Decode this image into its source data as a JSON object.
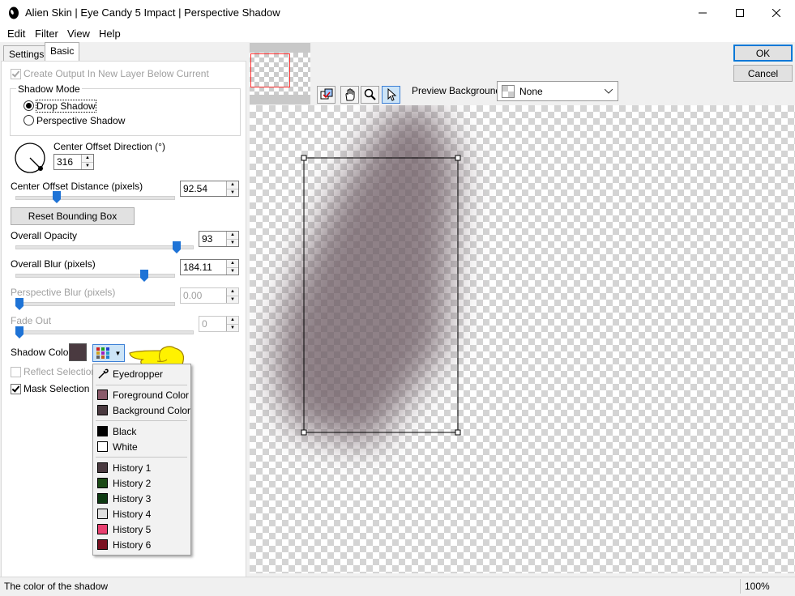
{
  "window": {
    "title": "Alien Skin | Eye Candy 5 Impact | Perspective Shadow",
    "minimize_icon": "minimize-icon",
    "maximize_icon": "maximize-icon",
    "close_icon": "close-icon"
  },
  "menu": {
    "edit": "Edit",
    "filter": "Filter",
    "view": "View",
    "help": "Help"
  },
  "tabs": {
    "settings": "Settings",
    "basic": "Basic"
  },
  "basic": {
    "create_output_label": "Create Output In New Layer Below Current",
    "create_output_checked": true,
    "shadow_mode_title": "Shadow Mode",
    "drop_shadow_label": "Drop Shadow",
    "perspective_shadow_label": "Perspective Shadow",
    "shadow_mode_selected": "Drop Shadow",
    "direction_label": "Center Offset Direction (°)",
    "direction_value": "316",
    "distance_label": "Center Offset Distance (pixels)",
    "distance_value": "92.54",
    "reset_bounding_box_label": "Reset Bounding Box",
    "opacity_label": "Overall Opacity",
    "opacity_value": "93",
    "blur_label": "Overall Blur (pixels)",
    "blur_value": "184.11",
    "perspective_blur_label": "Perspective Blur (pixels)",
    "perspective_blur_value": "0.00",
    "fade_out_label": "Fade Out",
    "fade_out_value": "0",
    "shadow_color_label": "Shadow Color",
    "shadow_color": "#4a3a40",
    "reflect_selection_label": "Reflect Selection",
    "reflect_selection_checked": false,
    "mask_selection_label": "Mask Selection",
    "mask_selection_checked": true
  },
  "color_menu": {
    "eyedropper": "Eyedropper",
    "foreground": {
      "label": "Foreground Color",
      "color": "#8a5a6a"
    },
    "background": {
      "label": "Background Color",
      "color": "#4a3a40"
    },
    "black": {
      "label": "Black",
      "color": "#000000"
    },
    "white": {
      "label": "White",
      "color": "#ffffff"
    },
    "history": [
      {
        "label": "History 1",
        "color": "#4a3a40"
      },
      {
        "label": "History 2",
        "color": "#1c4a16"
      },
      {
        "label": "History 3",
        "color": "#0e3a12"
      },
      {
        "label": "History 4",
        "color": "#e0e0e0"
      },
      {
        "label": "History 5",
        "color": "#e84070"
      },
      {
        "label": "History 6",
        "color": "#7a1020"
      }
    ]
  },
  "dialog": {
    "ok_label": "OK",
    "cancel_label": "Cancel",
    "preview_background_label": "Preview Background:",
    "preview_background_value": "None"
  },
  "status": {
    "hint": "The color of the shadow",
    "zoom": "100%"
  }
}
